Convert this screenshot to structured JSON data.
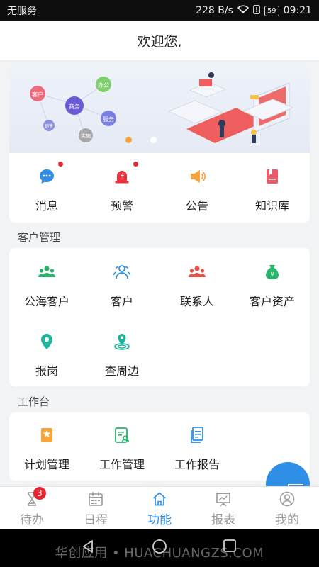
{
  "status_bar": {
    "carrier": "无服务",
    "net_speed": "228 B/s",
    "battery": "59",
    "time": "09:21"
  },
  "header": {
    "title": "欢迎您,"
  },
  "banner": {
    "bubbles": [
      "客户",
      "商务",
      "办公",
      "服务",
      "销售",
      "实施"
    ],
    "slides_total": 2,
    "active_slide": 1
  },
  "quick_actions": [
    {
      "label": "消息",
      "icon": "message-icon",
      "color": "#2f8ee5",
      "unread": true
    },
    {
      "label": "预警",
      "icon": "alarm-icon",
      "color": "#e8333b",
      "unread": true
    },
    {
      "label": "公告",
      "icon": "megaphone-icon",
      "color": "#f6a43b",
      "unread": false
    },
    {
      "label": "知识库",
      "icon": "book-icon",
      "color": "#ec5a6a",
      "unread": false
    }
  ],
  "customer_section": {
    "title": "客户管理",
    "items": [
      {
        "label": "公海客户",
        "icon": "group-icon",
        "color": "#27b36b"
      },
      {
        "label": "客户",
        "icon": "users-outline-icon",
        "color": "#2f8ee5"
      },
      {
        "label": "联系人",
        "icon": "contacts-icon",
        "color": "#e8524a"
      },
      {
        "label": "客户资产",
        "icon": "money-bag-icon",
        "color": "#27b36b"
      },
      {
        "label": "报岗",
        "icon": "location-pin-icon",
        "color": "#1fb39b"
      },
      {
        "label": "查周边",
        "icon": "nearby-icon",
        "color": "#1fb39b"
      }
    ]
  },
  "workbench_section": {
    "title": "工作台",
    "items": [
      {
        "label": "计划管理",
        "icon": "plan-icon",
        "color": "#f6a43b"
      },
      {
        "label": "工作管理",
        "icon": "work-manage-icon",
        "color": "#27b36b"
      },
      {
        "label": "工作报告",
        "icon": "report-icon",
        "color": "#2f8ee5"
      }
    ]
  },
  "fab": {
    "icon": "plus-icon"
  },
  "tab_bar": {
    "active_color": "#2f8ee5",
    "inactive_color": "#9b9b9b",
    "tabs": [
      {
        "label": "待办",
        "icon": "hourglass-icon",
        "badge": "3",
        "active": false
      },
      {
        "label": "日程",
        "icon": "calendar-icon",
        "active": false
      },
      {
        "label": "功能",
        "icon": "home-icon",
        "active": true
      },
      {
        "label": "报表",
        "icon": "chart-board-icon",
        "active": false
      },
      {
        "label": "我的",
        "icon": "user-icon",
        "active": false
      }
    ]
  },
  "watermark": "华创应用 • HUACHUANGZS.COM"
}
